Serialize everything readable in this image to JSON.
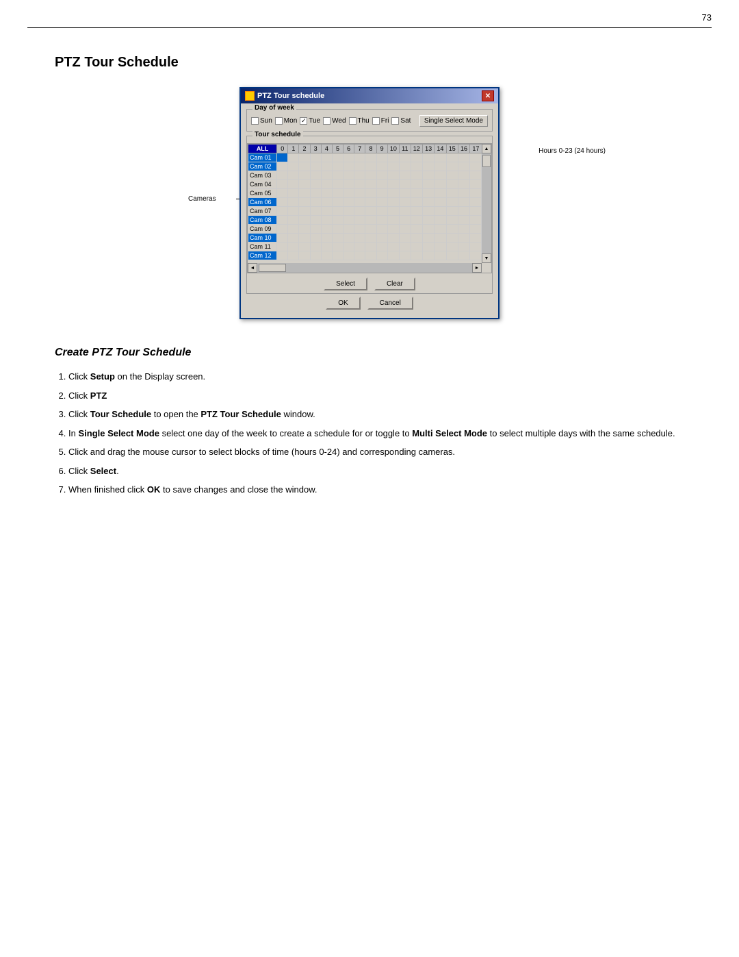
{
  "page": {
    "number": "73",
    "top_divider": true
  },
  "section1": {
    "title": "PTZ Tour Schedule"
  },
  "dialog": {
    "title": "PTZ Tour schedule",
    "close_btn": "✕",
    "day_of_week_label": "Day of week",
    "days": [
      {
        "label": "Sun",
        "checked": false
      },
      {
        "label": "Mon",
        "checked": false
      },
      {
        "label": "Tue",
        "checked": true
      },
      {
        "label": "Wed",
        "checked": false
      },
      {
        "label": "Thu",
        "checked": false
      },
      {
        "label": "Fri",
        "checked": false
      },
      {
        "label": "Sat",
        "checked": false
      }
    ],
    "single_select_btn": "Single Select Mode",
    "tour_schedule_label": "Tour schedule",
    "grid": {
      "col_headers": [
        "ALL",
        "0",
        "1",
        "2",
        "3",
        "4",
        "5",
        "6",
        "7",
        "8",
        "9",
        "10",
        "11",
        "12",
        "13",
        "14",
        "15",
        "16",
        "17"
      ],
      "rows": [
        {
          "label": "Cam 01",
          "selected": true,
          "cells": [
            1,
            0,
            0,
            0,
            0,
            0,
            0,
            0,
            0,
            0,
            0,
            0,
            0,
            0,
            0,
            0,
            0,
            0,
            0
          ]
        },
        {
          "label": "Cam 02",
          "selected": true,
          "cells": [
            0,
            0,
            0,
            0,
            0,
            0,
            0,
            0,
            0,
            0,
            0,
            0,
            0,
            0,
            0,
            0,
            0,
            0,
            0
          ]
        },
        {
          "label": "Cam 03",
          "selected": false,
          "cells": [
            0,
            0,
            0,
            0,
            0,
            0,
            0,
            0,
            0,
            0,
            0,
            0,
            0,
            0,
            0,
            0,
            0,
            0,
            0
          ]
        },
        {
          "label": "Cam 04",
          "selected": false,
          "cells": [
            0,
            0,
            0,
            0,
            0,
            0,
            0,
            0,
            0,
            0,
            0,
            0,
            0,
            0,
            0,
            0,
            0,
            0,
            0
          ]
        },
        {
          "label": "Cam 05",
          "selected": false,
          "cells": [
            0,
            0,
            0,
            0,
            0,
            0,
            0,
            0,
            0,
            0,
            0,
            0,
            0,
            0,
            0,
            0,
            0,
            0,
            0
          ]
        },
        {
          "label": "Cam 06",
          "selected": true,
          "cells": [
            0,
            0,
            0,
            0,
            0,
            0,
            0,
            0,
            0,
            0,
            0,
            0,
            0,
            0,
            0,
            0,
            0,
            0,
            0
          ]
        },
        {
          "label": "Cam 07",
          "selected": false,
          "cells": [
            0,
            0,
            0,
            0,
            0,
            0,
            0,
            0,
            0,
            0,
            0,
            0,
            0,
            0,
            0,
            0,
            0,
            0,
            0
          ]
        },
        {
          "label": "Cam 08",
          "selected": true,
          "cells": [
            0,
            0,
            0,
            0,
            0,
            0,
            0,
            0,
            0,
            0,
            0,
            0,
            0,
            0,
            0,
            0,
            0,
            0,
            0
          ]
        },
        {
          "label": "Cam 09",
          "selected": false,
          "cells": [
            0,
            0,
            0,
            0,
            0,
            0,
            0,
            0,
            0,
            0,
            0,
            0,
            0,
            0,
            0,
            0,
            0,
            0,
            0
          ]
        },
        {
          "label": "Cam 10",
          "selected": true,
          "cells": [
            0,
            0,
            0,
            0,
            0,
            0,
            0,
            0,
            0,
            0,
            0,
            0,
            0,
            0,
            0,
            0,
            0,
            0,
            0
          ]
        },
        {
          "label": "Cam 11",
          "selected": false,
          "cells": [
            0,
            0,
            0,
            0,
            0,
            0,
            0,
            0,
            0,
            0,
            0,
            0,
            0,
            0,
            0,
            0,
            0,
            0,
            0
          ]
        },
        {
          "label": "Cam 12",
          "selected": true,
          "cells": [
            0,
            0,
            0,
            0,
            0,
            0,
            0,
            0,
            0,
            0,
            0,
            0,
            0,
            0,
            0,
            0,
            0,
            0,
            0
          ]
        }
      ]
    },
    "select_btn": "Select",
    "clear_btn": "Clear",
    "ok_btn": "OK",
    "cancel_btn": "Cancel",
    "annotations": {
      "cameras": "Cameras",
      "hours": "Hours 0-23 (24 hours)"
    }
  },
  "section2": {
    "title": "Create PTZ Tour Schedule",
    "steps": [
      {
        "id": 1,
        "text": "Click ",
        "bold": "Setup",
        "text2": " on the Display screen."
      },
      {
        "id": 2,
        "text": "Click ",
        "bold": "PTZ",
        "text2": ""
      },
      {
        "id": 3,
        "text": "Click ",
        "bold": "Tour Schedule",
        "text2": " to open the ",
        "bold2": "PTZ Tour Schedule",
        "text3": " window."
      },
      {
        "id": 4,
        "text": "In ",
        "bold": "Single Select Mode",
        "text2": " select one day of the week to create a schedule for or toggle to ",
        "bold2": "Multi Select Mode",
        "text3": " to select multiple days with the same schedule."
      },
      {
        "id": 5,
        "text": "Click and drag the mouse cursor to select blocks of time (hours 0-24) and corresponding cameras."
      },
      {
        "id": 6,
        "text": "Click ",
        "bold": "Select",
        "text2": "."
      },
      {
        "id": 7,
        "text": "When finished click ",
        "bold": "OK",
        "text2": " to save changes and close the window."
      }
    ]
  }
}
